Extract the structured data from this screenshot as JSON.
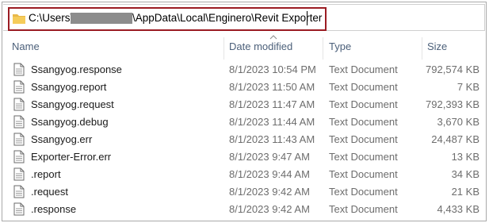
{
  "address": {
    "segment_1": "C:\\Users\\",
    "segment_2": "\\AppData\\Local\\Enginero\\Revit Exporter"
  },
  "columns": {
    "name": "Name",
    "date": "Date modified",
    "type": "Type",
    "size": "Size"
  },
  "files": [
    {
      "name": "Ssangyog.response",
      "date": "8/1/2023 10:54 PM",
      "type": "Text Document",
      "size": "792,574 KB"
    },
    {
      "name": "Ssangyog.report",
      "date": "8/1/2023 11:50 AM",
      "type": "Text Document",
      "size": "7 KB"
    },
    {
      "name": "Ssangyog.request",
      "date": "8/1/2023 11:47 AM",
      "type": "Text Document",
      "size": "792,393 KB"
    },
    {
      "name": "Ssangyog.debug",
      "date": "8/1/2023 11:44 AM",
      "type": "Text Document",
      "size": "3,670 KB"
    },
    {
      "name": "Ssangyog.err",
      "date": "8/1/2023 11:43 AM",
      "type": "Text Document",
      "size": "24,487 KB"
    },
    {
      "name": "Exporter-Error.err",
      "date": "8/1/2023 9:47 AM",
      "type": "Text Document",
      "size": "13 KB"
    },
    {
      "name": ".report",
      "date": "8/1/2023 9:44 AM",
      "type": "Text Document",
      "size": "34 KB"
    },
    {
      "name": ".request",
      "date": "8/1/2023 9:42 AM",
      "type": "Text Document",
      "size": "21 KB"
    },
    {
      "name": ".response",
      "date": "8/1/2023 9:42 AM",
      "type": "Text Document",
      "size": "4,433 KB"
    }
  ]
}
